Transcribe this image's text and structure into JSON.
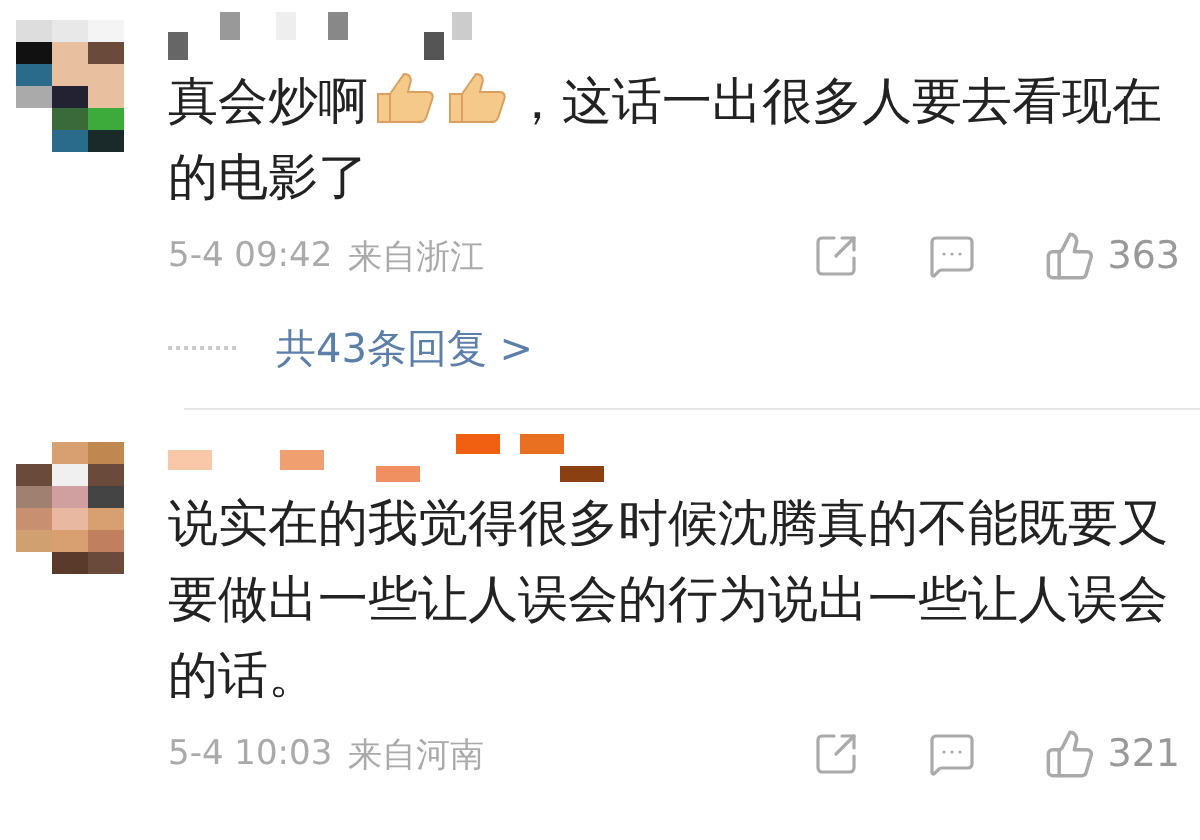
{
  "comments": [
    {
      "segments": [
        {
          "kind": "text",
          "text": "真会炒啊"
        },
        {
          "kind": "emoji"
        },
        {
          "kind": "emoji"
        },
        {
          "kind": "text",
          "text": "，这话一出很多人要去看现在"
        },
        {
          "kind": "new_line_text",
          "text": "的电影了"
        }
      ],
      "time": "5-4 09:42",
      "location": "来自浙江",
      "likes": "363",
      "replies_link": "共43条回复 >"
    },
    {
      "segments": [
        {
          "kind": "text",
          "text": "说实在的我觉得很多时候沈腾真的不能既要又要做出一些让人误会的行为说出一些让人误会的话。"
        }
      ],
      "time": "5-4 10:03",
      "location": "来自河南",
      "likes": "321"
    }
  ]
}
